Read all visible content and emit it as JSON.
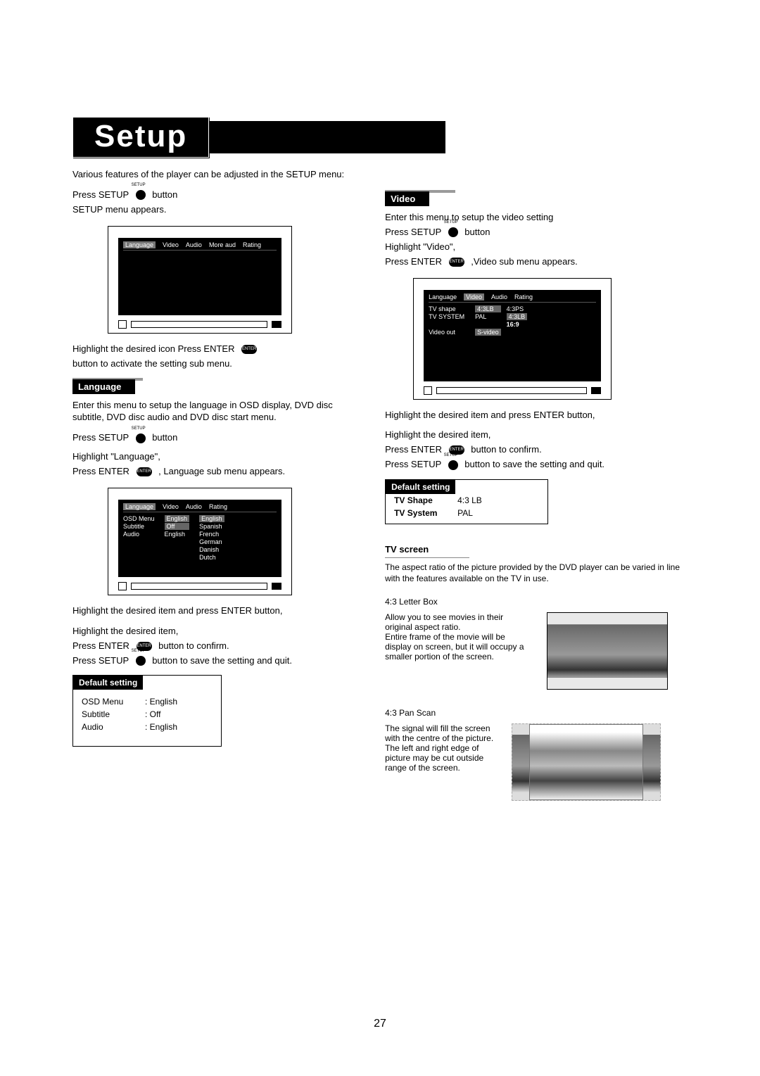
{
  "title": "Setup",
  "intro1": "Various features of the player can be adjusted in the SETUP menu:",
  "intro2a": "Press SETUP",
  "intro2b": "button",
  "intro3": "SETUP menu appears.",
  "menu1_tabs": [
    "Language",
    "Video",
    "Audio",
    "More  aud",
    "Rating"
  ],
  "after_menu1a": "Highlight the desired icon Press ENTER",
  "after_menu1b": "button to activate the setting sub menu.",
  "lang_head": "Language",
  "lang_p1": "Enter this menu to setup the language in OSD display, DVD disc subtitle, DVD disc audio and DVD disc start menu.",
  "lang_p2a": "Press SETUP",
  "lang_p2b": "button",
  "lang_p3": "Highlight \"Language\",",
  "lang_p4a": "Press ENTER",
  "lang_p4b": ", Language sub menu appears.",
  "menu2_tabs": [
    "Language",
    "Video",
    "Audio",
    "Rating"
  ],
  "menu2_left": [
    {
      "k": "OSD Menu",
      "v": "English"
    },
    {
      "k": "Subtitle",
      "v": "Off"
    },
    {
      "k": "Audio",
      "v": "English"
    }
  ],
  "menu2_right": [
    "English",
    "Spanish",
    "French",
    "German",
    "Danish",
    "Dutch"
  ],
  "lang_p5": "Highlight the desired item and press ENTER button,",
  "lang_p6": "Highlight the desired item,",
  "lang_p7a": "Press ENTER",
  "lang_p7b": "button to confirm.",
  "lang_p8a": "Press SETUP",
  "lang_p8b": "button to save the setting and quit.",
  "lang_default_head": "Default setting",
  "lang_defaults": [
    {
      "k": "OSD Menu",
      "v": ": English"
    },
    {
      "k": "Subtitle",
      "v": ": Off"
    },
    {
      "k": "Audio",
      "v": ": English"
    }
  ],
  "video_head": "Video",
  "video_p1": "Enter this menu to setup the video setting",
  "video_p2a": "Press SETUP",
  "video_p2b": "button",
  "video_p3": "Highlight \"Video\",",
  "video_p4a": "Press ENTER",
  "video_p4b": ",Video sub menu appears.",
  "menu3_tabs": [
    "Language",
    "Video",
    "Audio",
    "Rating"
  ],
  "menu3_rows": [
    {
      "k": "TV shape",
      "v1": "4:3LB",
      "v2": "4:3PS"
    },
    {
      "k": "TV SYSTEM",
      "v1": "PAL",
      "v2": "4:3LB"
    },
    {
      "k": "",
      "v1": "",
      "v2": "16:9"
    },
    {
      "k": "Video out",
      "v1": "S-video",
      "v2": ""
    }
  ],
  "video_p5": "Highlight the desired item and press ENTER button,",
  "video_p6": "Highlight the desired item,",
  "video_p7a": "Press ENTER",
  "video_p7b": "button to confirm.",
  "video_p8a": "Press SETUP",
  "video_p8b": "button to save the setting and quit.",
  "video_default_head": "Default setting",
  "video_defaults": [
    {
      "k": "TV Shape",
      "v": "4:3 LB"
    },
    {
      "k": "TV System",
      "v": "PAL"
    }
  ],
  "tvscreen_head": "TV screen",
  "tvscreen_p1": "The aspect ratio of the picture provided by the DVD player can be varied in line with the features available on the TV in use.",
  "lb_title": "4:3 Letter Box",
  "lb_text": "Allow you to see movies in their original aspect ratio.\nEntire frame of the movie will be display on screen, but it will occupy a smaller portion of the screen.",
  "ps_title": "4:3 Pan Scan",
  "ps_text": "The signal will fill the screen with the centre of the picture. The left and right edge of picture may be cut outside range of the screen.",
  "btn_setup_small": "SETUP",
  "btn_enter_small": "ENTER",
  "page_number": "27"
}
